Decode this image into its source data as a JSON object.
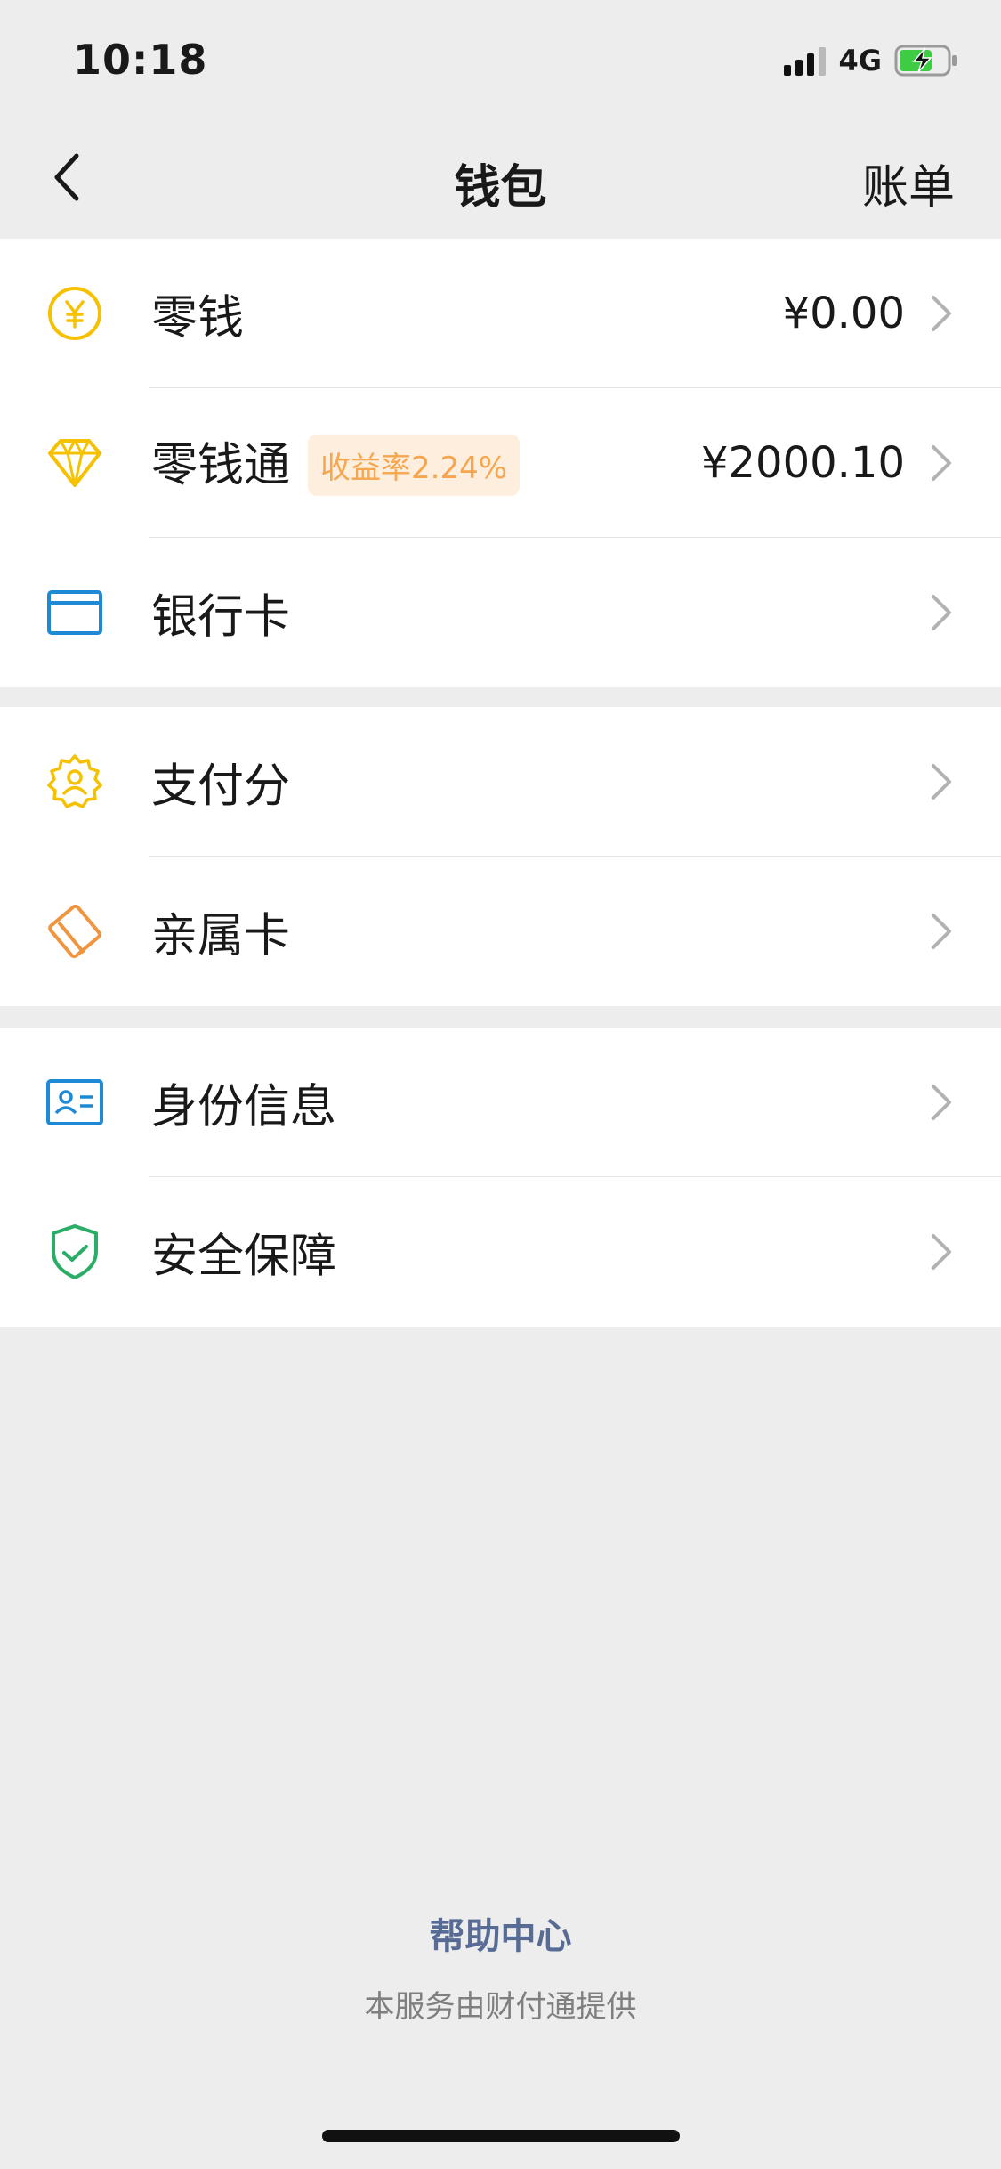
{
  "status_bar": {
    "time": "10:18",
    "network": "4G",
    "battery_color": "#3fcc45"
  },
  "nav": {
    "title": "钱包",
    "action": "账单"
  },
  "groups": [
    {
      "items": [
        {
          "label": "零钱",
          "value": "¥0.00",
          "icon": "yuan-coin-icon",
          "icon_color": "#f5c100"
        },
        {
          "label": "零钱通",
          "badge": "收益率2.24%",
          "value": "¥2000.10",
          "icon": "diamond-icon",
          "icon_color": "#f5c100"
        },
        {
          "label": "银行卡",
          "value": "",
          "icon": "bank-card-icon",
          "icon_color": "#1e8ad6"
        }
      ]
    },
    {
      "items": [
        {
          "label": "支付分",
          "icon": "pay-score-badge-icon",
          "icon_color": "#f5c100"
        },
        {
          "label": "亲属卡",
          "icon": "family-card-icon",
          "icon_color": "#f0943d"
        }
      ]
    },
    {
      "items": [
        {
          "label": "身份信息",
          "icon": "id-card-icon",
          "icon_color": "#1e8ad6"
        },
        {
          "label": "安全保障",
          "icon": "shield-check-icon",
          "icon_color": "#2aae67"
        }
      ]
    }
  ],
  "footer": {
    "help_link": "帮助中心",
    "provider": "本服务由财付通提供"
  },
  "colors": {
    "background": "#ededed",
    "link": "#576b95",
    "badge_text": "#f5a64e",
    "badge_bg": "#fdeedd"
  }
}
